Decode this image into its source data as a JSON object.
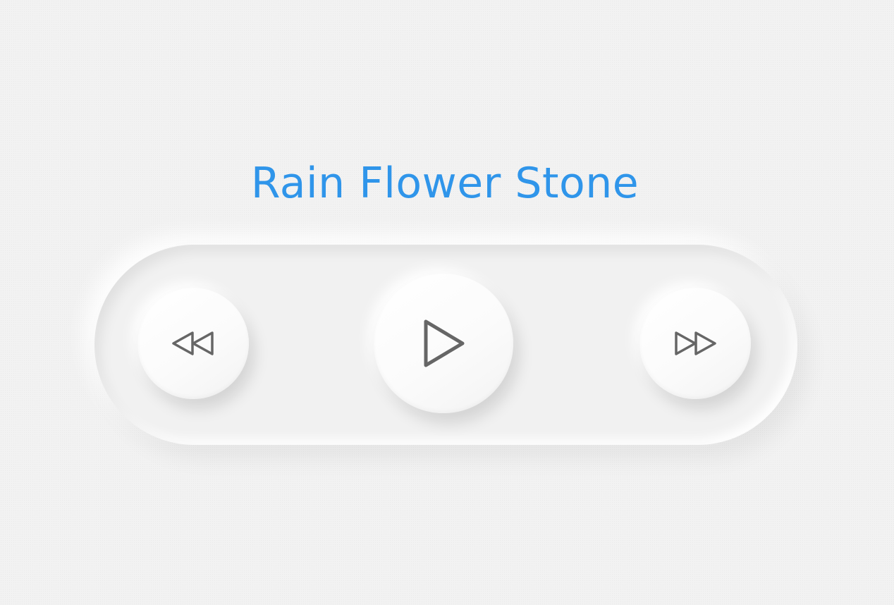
{
  "player": {
    "title": "Rain Flower Stone",
    "controls": {
      "rewind": {
        "icon": "rewind-icon"
      },
      "play": {
        "icon": "play-icon"
      },
      "forward": {
        "icon": "fast-forward-icon"
      }
    }
  },
  "colors": {
    "title": "#2f95ea",
    "icon": "#666666",
    "background": "#f2f2f2"
  }
}
